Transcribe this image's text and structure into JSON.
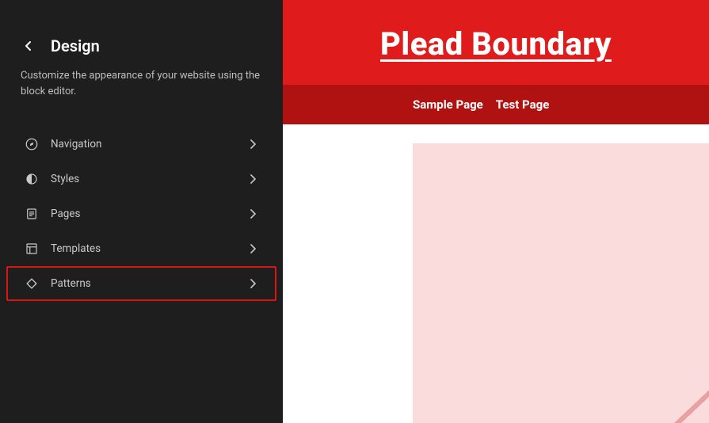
{
  "sidebar": {
    "title": "Design",
    "description": "Customize the appearance of your website using the block editor.",
    "items": [
      {
        "label": "Navigation",
        "icon": "compass-icon",
        "highlight": false
      },
      {
        "label": "Styles",
        "icon": "half-circle-icon",
        "highlight": false
      },
      {
        "label": "Pages",
        "icon": "page-icon",
        "highlight": false
      },
      {
        "label": "Templates",
        "icon": "layout-icon",
        "highlight": false
      },
      {
        "label": "Patterns",
        "icon": "diamond-icon",
        "highlight": true
      }
    ]
  },
  "site": {
    "title": "Plead Boundary",
    "nav": [
      {
        "label": "Sample Page"
      },
      {
        "label": "Test Page"
      }
    ]
  },
  "colors": {
    "hero": "#e01b1b",
    "nav": "#b01111",
    "highlight_border": "#d71616"
  }
}
